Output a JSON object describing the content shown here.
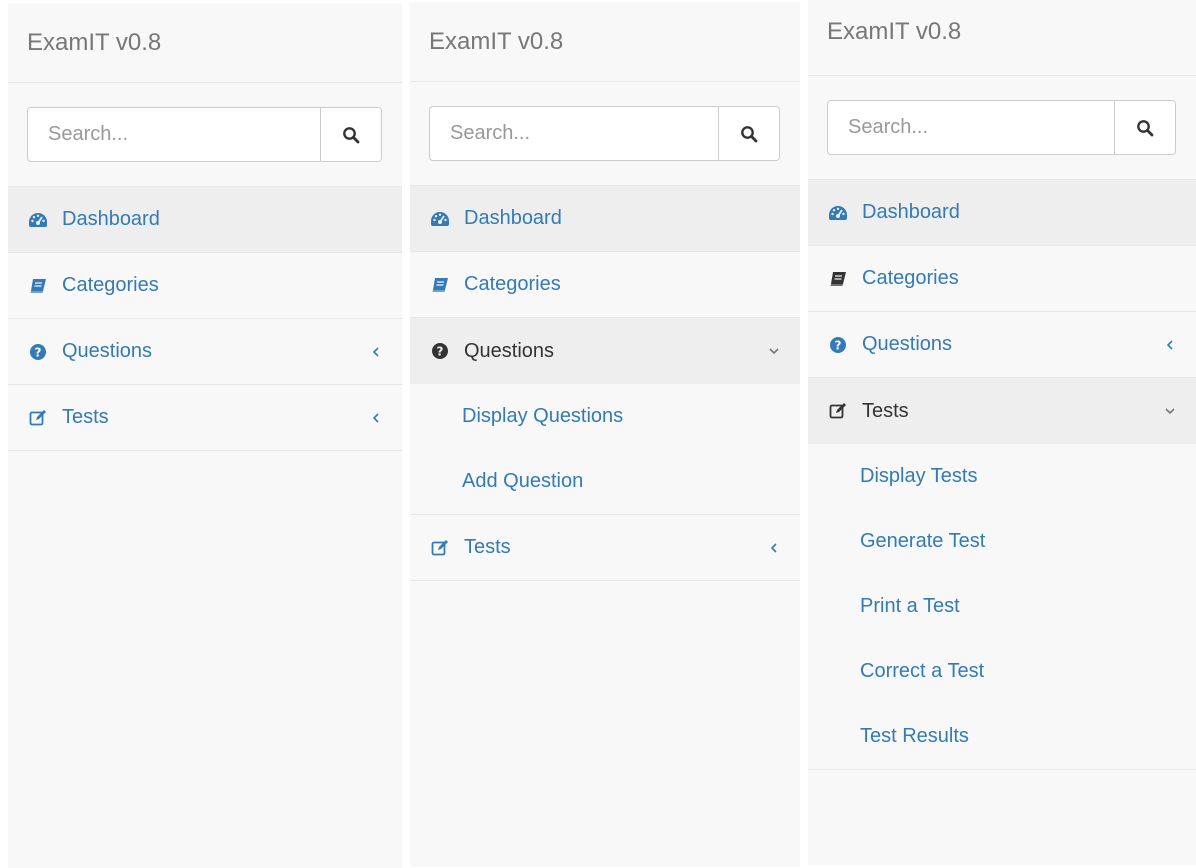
{
  "panels": [
    {
      "brand": "ExamIT v0.8",
      "search": {
        "placeholder": "Search..."
      },
      "nav": {
        "dashboard": "Dashboard",
        "categories": "Categories",
        "questions": "Questions",
        "tests": "Tests"
      }
    },
    {
      "brand": "ExamIT v0.8",
      "search": {
        "placeholder": "Search..."
      },
      "nav": {
        "dashboard": "Dashboard",
        "categories": "Categories",
        "questions": "Questions",
        "questions_sub": [
          "Display Questions",
          "Add Question"
        ],
        "tests": "Tests"
      }
    },
    {
      "brand": "ExamIT v0.8",
      "search": {
        "placeholder": "Search..."
      },
      "nav": {
        "dashboard": "Dashboard",
        "categories": "Categories",
        "questions": "Questions",
        "tests": "Tests",
        "tests_sub": [
          "Display Tests",
          "Generate Test",
          "Print a Test",
          "Correct a Test",
          "Test Results"
        ]
      }
    }
  ],
  "icons": {
    "search": "search-icon",
    "dashboard": "dashboard-icon",
    "categories": "book-icon",
    "questions": "question-circle-icon",
    "tests": "edit-icon",
    "collapsed": "chevron-left-icon",
    "expanded": "chevron-down-icon"
  },
  "colors": {
    "link": "#337ab7",
    "brand_text": "#777777",
    "sidebar_bg": "#f8f8f8",
    "active_bg": "#eeeeee"
  }
}
